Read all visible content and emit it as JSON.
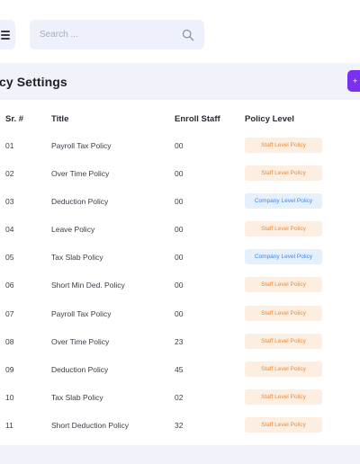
{
  "search": {
    "placeholder": "Search ..."
  },
  "header": {
    "title": "licy Settings",
    "add_button_glyph": "+"
  },
  "table": {
    "columns": [
      "Sr. #",
      "Title",
      "Enroll Staff",
      "Policy Level"
    ],
    "rows": [
      {
        "sr": "01",
        "title": "Payroll Tax Policy",
        "enroll": "00",
        "level": "Staff Level Policy",
        "type": "staff"
      },
      {
        "sr": "02",
        "title": "Over Time Policy",
        "enroll": "00",
        "level": "Staff Level Policy",
        "type": "staff"
      },
      {
        "sr": "03",
        "title": "Deduction Policy",
        "enroll": "00",
        "level": "Company Level Policy",
        "type": "company"
      },
      {
        "sr": "04",
        "title": "Leave Policy",
        "enroll": "00",
        "level": "Staff Level Policy",
        "type": "staff"
      },
      {
        "sr": "05",
        "title": "Tax Slab Policy",
        "enroll": "00",
        "level": "Company Level Policy",
        "type": "company"
      },
      {
        "sr": "06",
        "title": "Short Min Ded. Policy",
        "enroll": "00",
        "level": "Staff Level Policy",
        "type": "staff"
      },
      {
        "sr": "07",
        "title": "Payroll Tax Policy",
        "enroll": "00",
        "level": "Staff Level Policy",
        "type": "staff"
      },
      {
        "sr": "08",
        "title": "Over Time Policy",
        "enroll": "23",
        "level": "Staff Level Policy",
        "type": "staff"
      },
      {
        "sr": "09",
        "title": "Deduction Policy",
        "enroll": "45",
        "level": "Staff Level Policy",
        "type": "staff"
      },
      {
        "sr": "10",
        "title": "Tax Slab Policy",
        "enroll": "02",
        "level": "Staff Level Policy",
        "type": "staff"
      },
      {
        "sr": "11",
        "title": "Short Deduction Policy",
        "enroll": "32",
        "level": "Staff Level Policy",
        "type": "staff"
      }
    ]
  },
  "icons": {
    "menu": "hamburger-icon",
    "search": "search-icon",
    "add": "plus-icon"
  },
  "colors": {
    "accent": "#7b2ff0",
    "staff_badge_text": "#f0882e",
    "company_badge_text": "#3d86e6",
    "panel_bg": "#f1f3fb"
  }
}
